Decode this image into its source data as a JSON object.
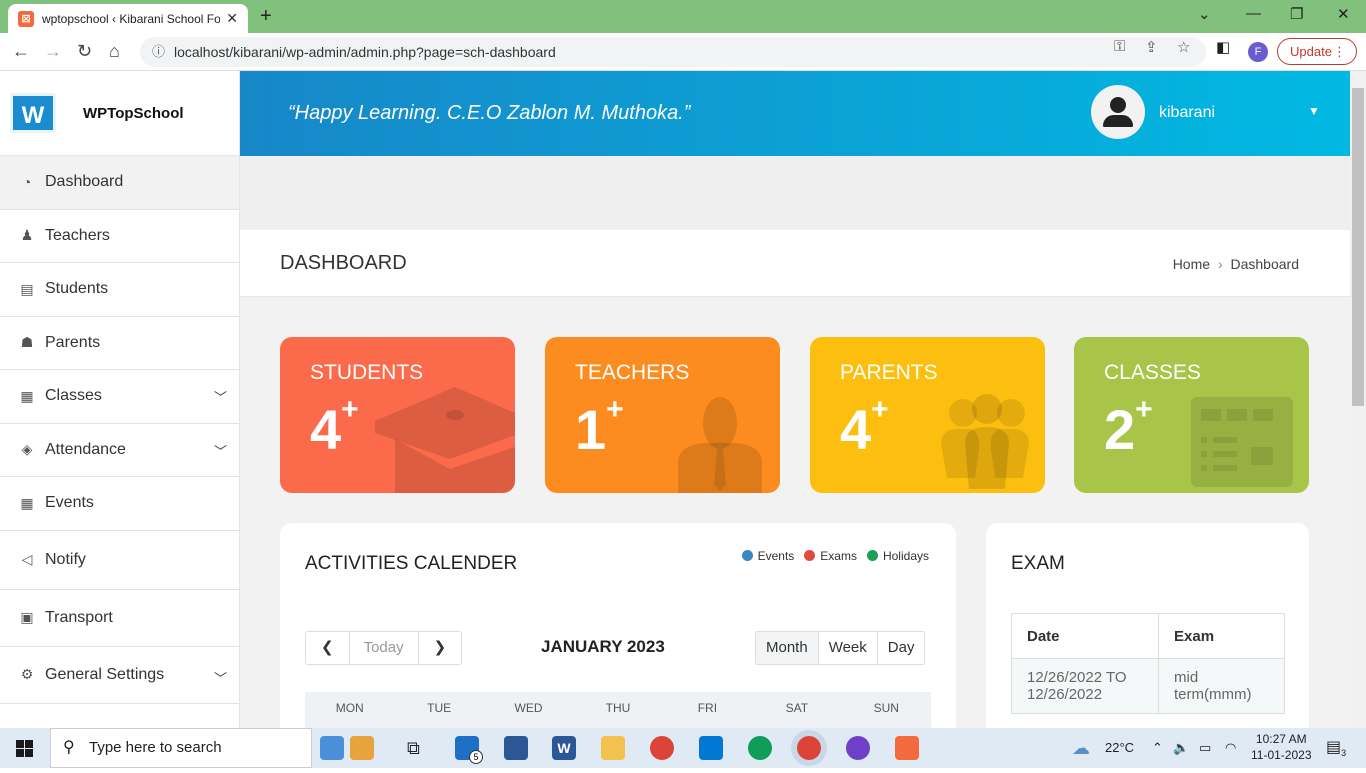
{
  "browser": {
    "tab_title": "wptopschool ‹ Kibarani School Fo",
    "url": "localhost/kibarani/wp-admin/admin.php?page=sch-dashboard",
    "profile_initial": "F",
    "update_label": "Update"
  },
  "sidebar": {
    "brand": "WPTopSchool",
    "items": [
      {
        "label": "Dashboard",
        "icon": "dashboard-icon"
      },
      {
        "label": "Teachers",
        "icon": "teacher-icon"
      },
      {
        "label": "Students",
        "icon": "id-card-icon"
      },
      {
        "label": "Parents",
        "icon": "group-icon"
      },
      {
        "label": "Classes",
        "icon": "table-icon"
      },
      {
        "label": "Attendance",
        "icon": "tag-icon"
      },
      {
        "label": "Events",
        "icon": "calendar-icon"
      },
      {
        "label": "Notify",
        "icon": "megaphone-icon"
      },
      {
        "label": "Transport",
        "icon": "bus-icon"
      },
      {
        "label": "General Settings",
        "icon": "gear-icon"
      }
    ]
  },
  "header": {
    "quote": "“Happy Learning. C.E.O Zablon M. Muthoka.”",
    "username": "kibarani"
  },
  "page": {
    "title": "DASHBOARD",
    "breadcrumb_home": "Home",
    "breadcrumb_current": "Dashboard"
  },
  "stats": [
    {
      "label": "STUDENTS",
      "value": "4",
      "suffix": "+",
      "color": "#fb6a4a"
    },
    {
      "label": "TEACHERS",
      "value": "1",
      "suffix": "+",
      "color": "#fc8c1f"
    },
    {
      "label": "PARENTS",
      "value": "4",
      "suffix": "+",
      "color": "#fdbf0f"
    },
    {
      "label": "CLASSES",
      "value": "2",
      "suffix": "+",
      "color": "#a8c54a"
    }
  ],
  "calendar": {
    "title": "ACTIVITIES CALENDER",
    "legend": [
      {
        "label": "Events",
        "color": "#3a87c4"
      },
      {
        "label": "Exams",
        "color": "#e04b3b"
      },
      {
        "label": "Holidays",
        "color": "#1aa057"
      }
    ],
    "today_label": "Today",
    "month_label": "JANUARY 2023",
    "views": [
      "Month",
      "Week",
      "Day"
    ],
    "days": [
      "MON",
      "TUE",
      "WED",
      "THU",
      "FRI",
      "SAT",
      "SUN"
    ]
  },
  "exam": {
    "title": "EXAM",
    "headers": [
      "Date",
      "Exam"
    ],
    "rows": [
      {
        "date": "12/26/2022 TO 12/26/2022",
        "exam": "mid term(mmm)"
      }
    ]
  },
  "taskbar": {
    "search_placeholder": "Type here to search",
    "mail_badge": "5",
    "weather": "22°C",
    "time": "10:27 AM",
    "date": "11-01-2023",
    "notification_count": "3"
  }
}
